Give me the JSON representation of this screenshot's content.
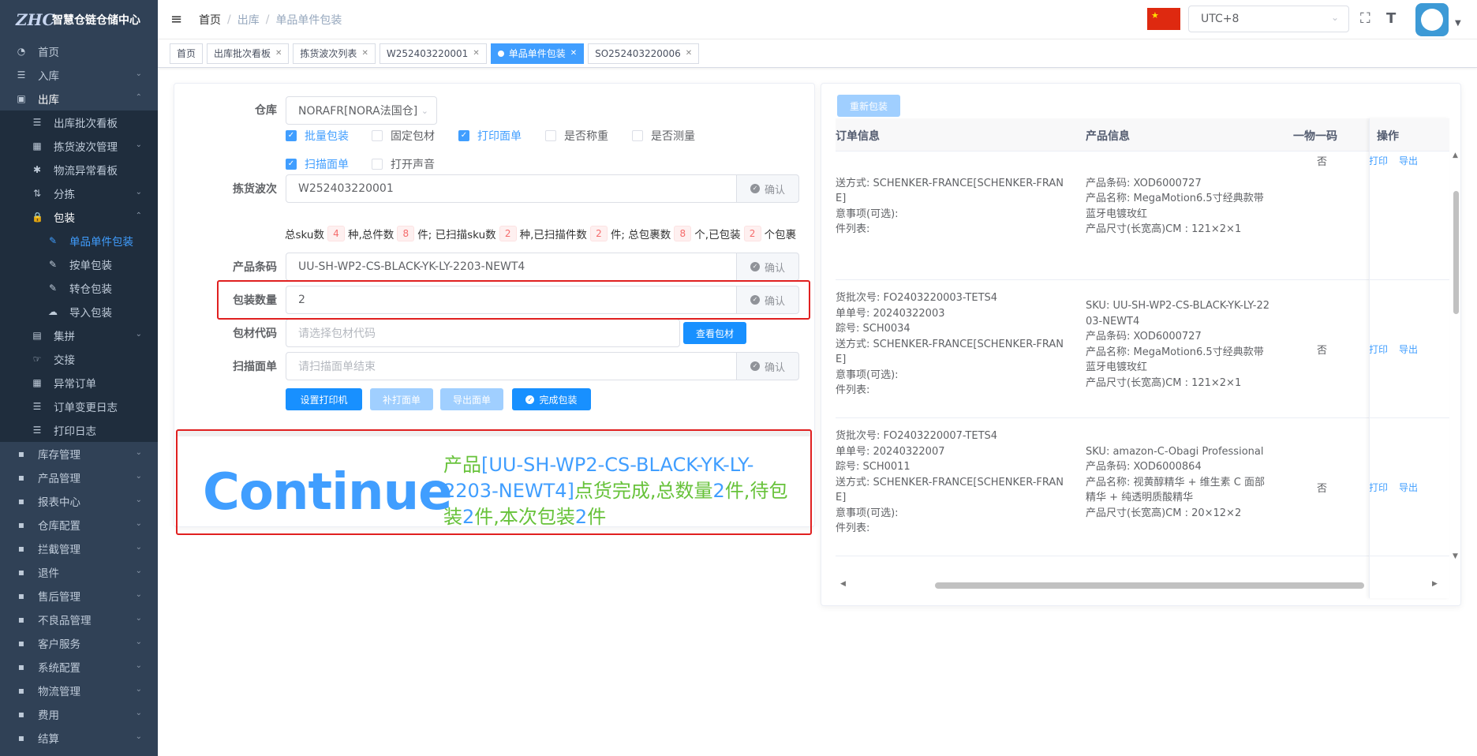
{
  "sidebar": {
    "logo_mark": "ZHC",
    "title": "智慧仓链仓储中心",
    "items": [
      {
        "label": "首页",
        "icon": "dashboard-icon"
      },
      {
        "label": "入库",
        "icon": "list-icon"
      },
      {
        "label": "出库",
        "icon": "outbound-icon"
      }
    ],
    "outbound_children": [
      {
        "label": "出库批次看板",
        "icon": "list-icon"
      },
      {
        "label": "拣货波次管理",
        "icon": "table-icon"
      },
      {
        "label": "物流异常看板",
        "icon": "bug-icon"
      },
      {
        "label": "分拣",
        "icon": "sort-icon"
      },
      {
        "label": "包装",
        "icon": "lock-icon"
      }
    ],
    "pack_children": [
      {
        "label": "单品单件包装",
        "icon": "edit-icon"
      },
      {
        "label": "按单包装",
        "icon": "edit-icon"
      },
      {
        "label": "转仓包装",
        "icon": "edit-icon"
      },
      {
        "label": "导入包装",
        "icon": "upload-icon"
      }
    ],
    "after_pack": [
      {
        "label": "集拼",
        "icon": "collect-icon"
      },
      {
        "label": "交接",
        "icon": "handover-icon"
      },
      {
        "label": "异常订单",
        "icon": "table-icon"
      },
      {
        "label": "订单变更日志",
        "icon": "list-icon"
      },
      {
        "label": "打印日志",
        "icon": "list-icon"
      }
    ],
    "bottom_items": [
      {
        "label": "库存管理"
      },
      {
        "label": "产品管理"
      },
      {
        "label": "报表中心"
      },
      {
        "label": "仓库配置"
      },
      {
        "label": "拦截管理"
      },
      {
        "label": "退件"
      },
      {
        "label": "售后管理"
      },
      {
        "label": "不良品管理"
      },
      {
        "label": "客户服务"
      },
      {
        "label": "系统配置"
      },
      {
        "label": "物流管理"
      },
      {
        "label": "费用"
      },
      {
        "label": "结算"
      },
      {
        "label": "系统"
      }
    ]
  },
  "header": {
    "breadcrumb": [
      "首页",
      "出库",
      "单品单件包装"
    ],
    "timezone": "UTC+8",
    "flag": "★"
  },
  "tags": [
    {
      "label": "首页"
    },
    {
      "label": "出库批次看板"
    },
    {
      "label": "拣货波次列表"
    },
    {
      "label": "W252403220001"
    },
    {
      "label": "单品单件包装"
    },
    {
      "label": "SO252403220006"
    }
  ],
  "form": {
    "warehouse_label": "仓库",
    "warehouse_value": "NORAFR[NORA法国仓]",
    "checkboxes": [
      {
        "label": "批量包装",
        "checked": true
      },
      {
        "label": "固定包材",
        "checked": false
      },
      {
        "label": "打印面单",
        "checked": true
      },
      {
        "label": "是否称重",
        "checked": false
      },
      {
        "label": "是否测量",
        "checked": false
      },
      {
        "label": "扫描面单",
        "checked": true
      },
      {
        "label": "打开声音",
        "checked": false
      }
    ],
    "wave_label": "拣货波次",
    "wave_value": "W252403220001",
    "confirm": "确认",
    "stats": {
      "t1": "总sku数",
      "v1": "4",
      "t2": "种,总件数",
      "v2": "8",
      "t3": "件; 已扫描sku数",
      "v3": "2",
      "t4": "种,已扫描件数",
      "v4": "2",
      "t5": "件; 总包裹数",
      "v5": "8",
      "t6": "个,已包装",
      "v6": "2",
      "t7": "个包裹"
    },
    "barcode_label": "产品条码",
    "barcode_value": "UU-SH-WP2-CS-BLACK-YK-LY-2203-NEWT4",
    "qty_label": "包装数量",
    "qty_value": "2",
    "material_label": "包材代码",
    "material_placeholder": "请选择包材代码",
    "view_material": "查看包材",
    "scan_label": "扫描面单",
    "scan_placeholder": "请扫描面单结束",
    "buttons": {
      "printer": "设置打印机",
      "reprint": "补打面单",
      "export": "导出面单",
      "finish": "完成包装"
    }
  },
  "result": {
    "big": "Continue",
    "m1": "产品",
    "m2": "[UU-SH-WP2-CS-BLACK-YK-LY-2203-NEWT4]",
    "m3": "点货完成,总数量",
    "m4": "2",
    "m5": "件,待包装",
    "m6": "2",
    "m7": "件,本次包装",
    "m8": "2",
    "m9": "件"
  },
  "table": {
    "repack": "重新包装",
    "headers": [
      "订单信息",
      "产品信息",
      "一物一码",
      "操作"
    ],
    "op_print": "打印",
    "op_export": "导出",
    "rows": [
      {
        "order": [
          "送方式: SCHENKER-FRANCE[SCHENKER-FRAN",
          "E]",
          "意事项(可选):",
          "件列表:"
        ],
        "product": [
          "产品条码: XOD6000727",
          "产品名称: MegaMotion6.5寸经典款带",
          "蓝牙电镀玫红",
          "产品尺寸(长宽高)CM : 121×2×1"
        ],
        "code": "否"
      },
      {
        "order": [
          "货批次号: FO2403220003-TETS4",
          "单单号: 20240322003",
          "踪号: SCH0034",
          "送方式: SCHENKER-FRANCE[SCHENKER-FRAN",
          "E]",
          "意事项(可选):",
          "件列表:"
        ],
        "product": [
          "SKU: UU-SH-WP2-CS-BLACK-YK-LY-22",
          "03-NEWT4",
          "产品条码: XOD6000727",
          "产品名称: MegaMotion6.5寸经典款带",
          "蓝牙电镀玫红",
          "产品尺寸(长宽高)CM : 121×2×1"
        ],
        "code": "否"
      },
      {
        "order": [
          "货批次号: FO2403220007-TETS4",
          "单单号: 20240322007",
          "踪号: SCH0011",
          "送方式: SCHENKER-FRANCE[SCHENKER-FRAN",
          "E]",
          "意事项(可选):",
          "件列表:"
        ],
        "product": [
          "SKU: amazon-C-Obagi Professional",
          "产品条码: XOD6000864",
          "产品名称: 视黄醇精华 + 维生素 C 面部",
          "精华 + 纯透明质酸精华",
          "产品尺寸(长宽高)CM : 20×12×2"
        ],
        "code": "否"
      }
    ]
  }
}
